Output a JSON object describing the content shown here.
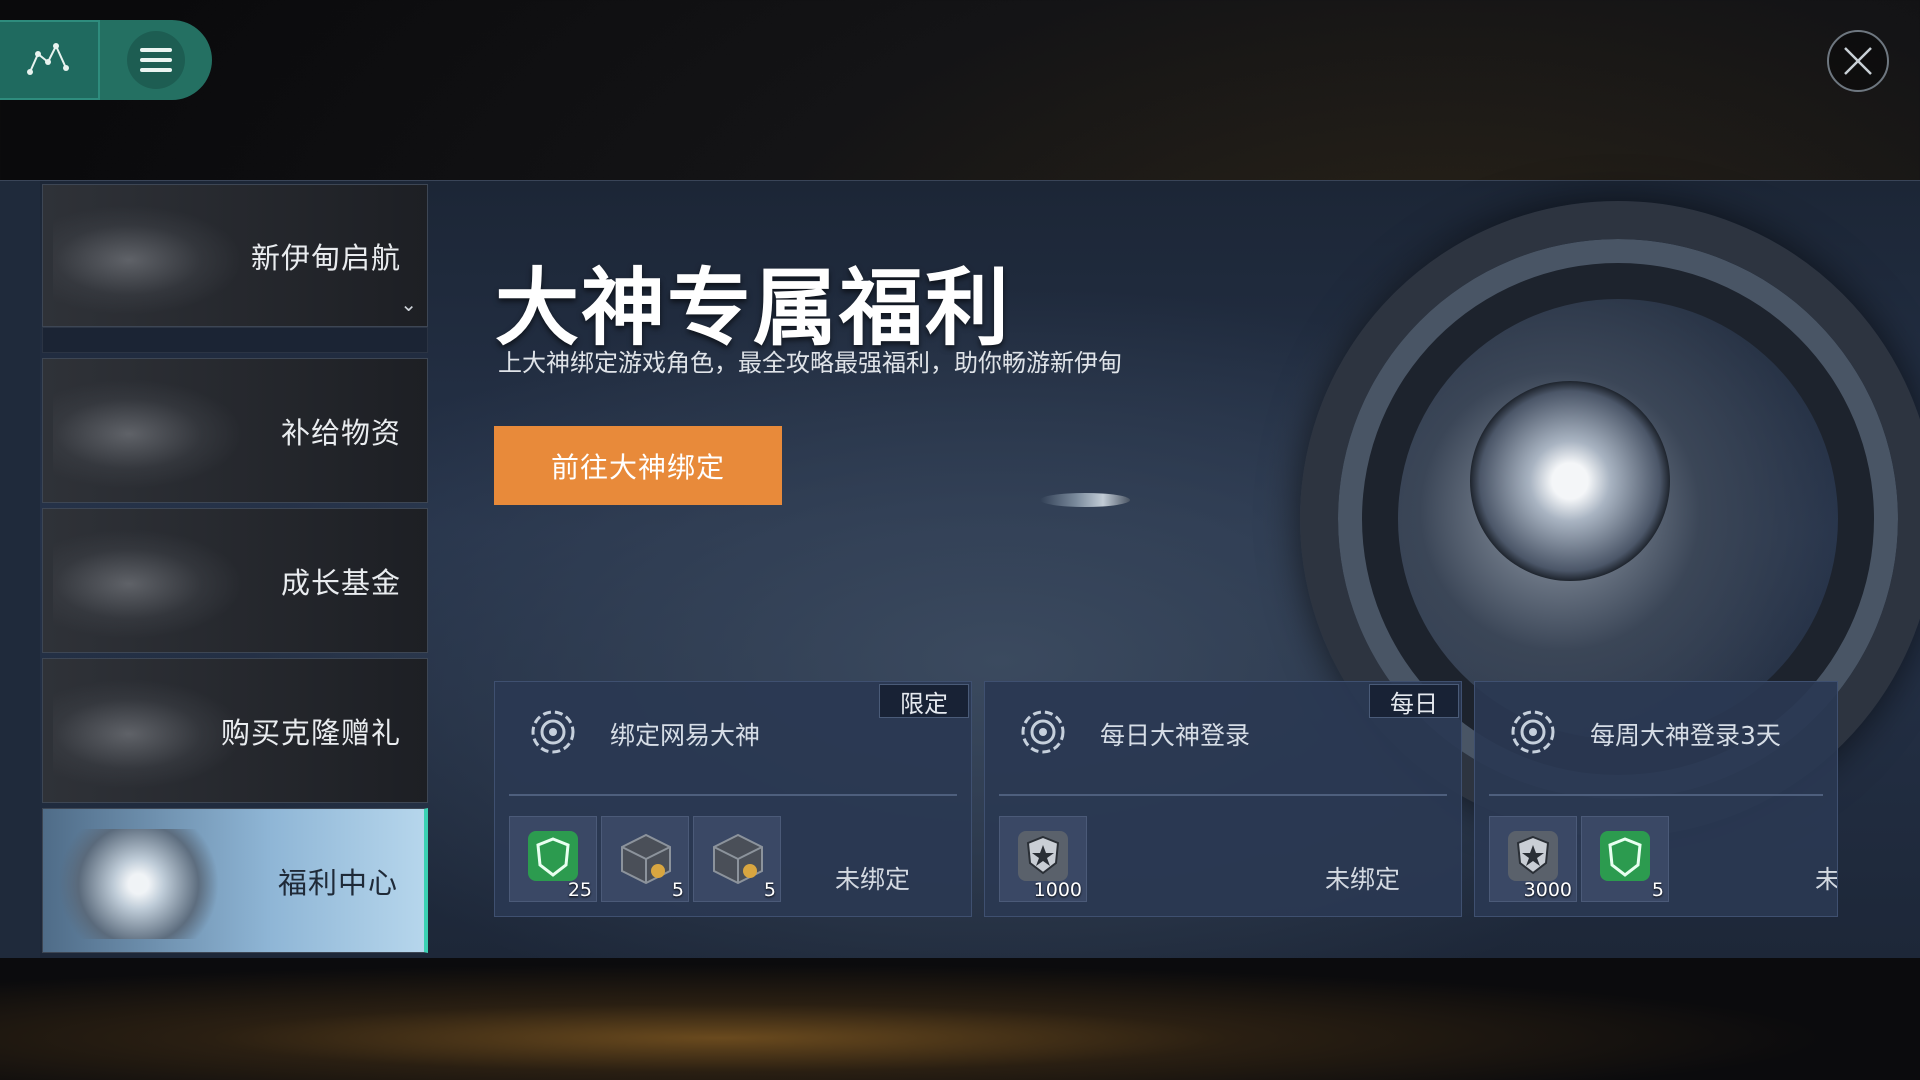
{
  "hud": {
    "map_icon": "star-map-icon",
    "menu_icon": "hamburger-menu-icon",
    "close_icon": "close-icon"
  },
  "sidebar": {
    "items": [
      {
        "label": "新伊甸启航",
        "active": false,
        "has_dropdown": true
      },
      {
        "label": "补给物资",
        "active": false
      },
      {
        "label": "成长基金",
        "active": false
      },
      {
        "label": "购买克隆赠礼",
        "active": false
      },
      {
        "label": "福利中心",
        "active": true
      }
    ]
  },
  "main": {
    "title": "大神专属福利",
    "subtitle": "上大神绑定游戏角色，最全攻略最强福利，助你畅游新伊甸",
    "cta_label": "前往大神绑定"
  },
  "cards": [
    {
      "title": "绑定网易大神",
      "tag": "限定",
      "status": "未绑定",
      "rewards": [
        {
          "icon": "green-shield-icon",
          "count": "25"
        },
        {
          "icon": "crate-icon",
          "count": "5"
        },
        {
          "icon": "crate-icon",
          "count": "5"
        }
      ]
    },
    {
      "title": "每日大神登录",
      "tag": "每日",
      "status": "未绑定",
      "rewards": [
        {
          "icon": "star-badge-icon",
          "count": "1000"
        }
      ]
    },
    {
      "title": "每周大神登录3天",
      "tag": "",
      "status": "未",
      "rewards": [
        {
          "icon": "star-badge-icon",
          "count": "3000"
        },
        {
          "icon": "green-shield-icon",
          "count": "5"
        }
      ]
    }
  ],
  "colors": {
    "accent_orange": "#e88a3a",
    "hud_teal": "#247062",
    "active_tab": "#8fb6d6",
    "card_bg": "#2a3852"
  }
}
